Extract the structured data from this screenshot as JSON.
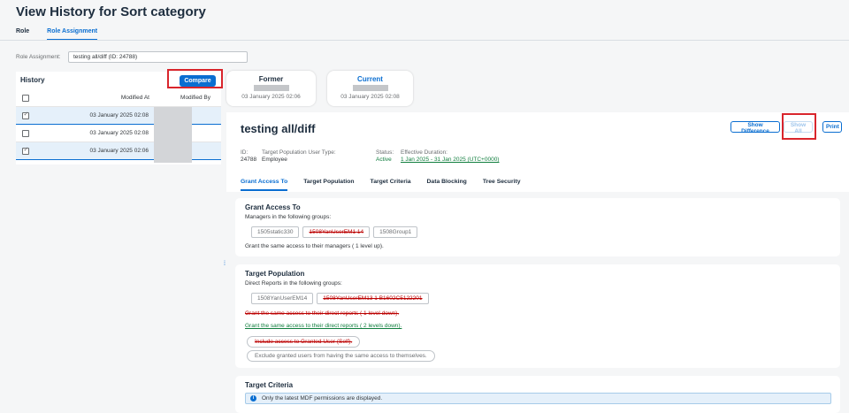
{
  "page": {
    "title": "View History for Sort category"
  },
  "main_tabs": [
    {
      "label": "Role"
    },
    {
      "label": "Role Assignment"
    }
  ],
  "role_assignment": {
    "label": "Role Assignment:",
    "value": "testing all/diff (ID: 24788)"
  },
  "history": {
    "title": "History",
    "compare_label": "Compare",
    "col_modified_at": "Modified At",
    "col_modified_by": "Modified By",
    "rows": [
      {
        "date": "03 January 2025 02:08",
        "checked": true
      },
      {
        "date": "03 January 2025 02:08",
        "checked": false
      },
      {
        "date": "03 January 2025 02:06",
        "checked": true
      }
    ]
  },
  "versions": {
    "former": {
      "title": "Former",
      "date": "03 January 2025 02:06"
    },
    "current": {
      "title": "Current",
      "date": "03 January 2025 02:08"
    }
  },
  "detail": {
    "title": "testing all/diff",
    "show_difference": "Show Difference",
    "show_all": "Show All",
    "print": "Print",
    "id_label": "ID:",
    "id_value": "24788",
    "type_label": "Target Population User Type:",
    "type_value": "Employee",
    "status_label": "Status:",
    "status_value": "Active",
    "duration_label": "Effective Duration:",
    "duration_value": "1 Jan 2025 - 31 Jan 2025 (UTC+0000)"
  },
  "sub_tabs": [
    {
      "label": "Grant Access To"
    },
    {
      "label": "Target Population"
    },
    {
      "label": "Target Criteria"
    },
    {
      "label": "Data Blocking"
    },
    {
      "label": "Tree Security"
    }
  ],
  "grant_access": {
    "title": "Grant Access To",
    "subtitle": "Managers in the following groups:",
    "tokens": [
      "1505static330",
      "1508YanUserEM1 14",
      "1508Group1"
    ],
    "managers_line": "Grant the same access to their managers ( 1  level up)."
  },
  "target_population": {
    "title": "Target Population",
    "subtitle": "Direct Reports in the following groups:",
    "tokens": [
      "1508YanUserEM14",
      "1508YanUserEM13 1 B1602C5122201"
    ],
    "deleted_line": "Grant the same access to their direct reports ( 1  level down).",
    "added_line": "Grant the same access to their direct reports ( 2  levels down).",
    "pill_deleted": "Include access to Granted User (Self).",
    "pill_normal": "Exclude granted users from having the same access to themselves."
  },
  "target_criteria": {
    "title": "Target Criteria",
    "info": "Only the latest MDF permissions are displayed."
  },
  "colors": {
    "accent": "#0a6ed1",
    "deleted": "#bb0000",
    "added": "#107e3e",
    "highlight_box": "#d9252c"
  },
  "icons": {
    "info": "info-icon",
    "checkbox": "checkbox-icon",
    "splitter": "splitter-grip-icon"
  }
}
